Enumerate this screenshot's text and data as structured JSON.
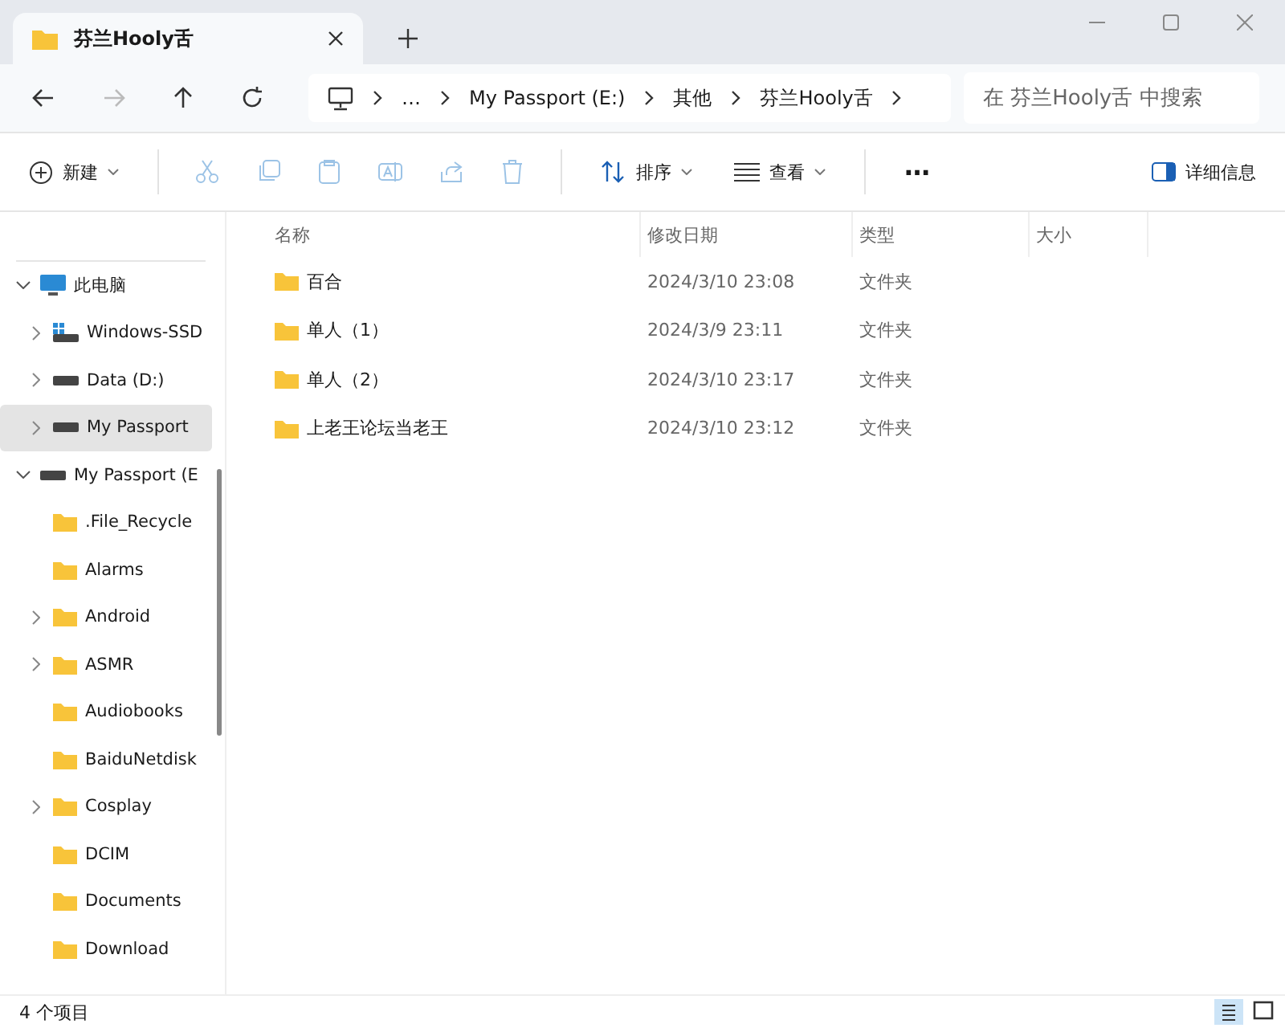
{
  "window": {
    "tab_title": "芬兰Hooly舌"
  },
  "address": {
    "crumbs": [
      "…",
      "My Passport (E:)",
      "其他",
      "芬兰Hooly舌"
    ],
    "search_placeholder": "在 芬兰Hooly舌 中搜索"
  },
  "toolbar": {
    "new": "新建",
    "sort": "排序",
    "view": "查看",
    "more": "⋯",
    "details": "详细信息"
  },
  "sidebar": {
    "items": [
      {
        "label": "此电脑",
        "kind": "pc",
        "expandable": true,
        "expanded": true,
        "selected": false,
        "children": [
          {
            "label": "Windows-SSD",
            "kind": "system-drive",
            "expandable": true,
            "expanded": false,
            "selected": false
          },
          {
            "label": "Data (D:)",
            "kind": "drive",
            "expandable": true,
            "expanded": false,
            "selected": false
          },
          {
            "label": "My Passport",
            "kind": "drive",
            "expandable": true,
            "expanded": false,
            "selected": true
          }
        ]
      },
      {
        "label": "My Passport (E",
        "kind": "drive",
        "expandable": true,
        "expanded": true,
        "selected": false,
        "children": [
          {
            "label": ".File_Recycle",
            "kind": "folder",
            "expandable": false,
            "selected": false
          },
          {
            "label": "Alarms",
            "kind": "folder",
            "expandable": false,
            "selected": false
          },
          {
            "label": "Android",
            "kind": "folder",
            "expandable": true,
            "expanded": false,
            "selected": false
          },
          {
            "label": "ASMR",
            "kind": "folder",
            "expandable": true,
            "expanded": false,
            "selected": false
          },
          {
            "label": "Audiobooks",
            "kind": "folder",
            "expandable": false,
            "selected": false
          },
          {
            "label": "BaiduNetdisk",
            "kind": "folder",
            "expandable": false,
            "selected": false
          },
          {
            "label": "Cosplay",
            "kind": "folder",
            "expandable": true,
            "expanded": false,
            "selected": false
          },
          {
            "label": "DCIM",
            "kind": "folder",
            "expandable": false,
            "selected": false
          },
          {
            "label": "Documents",
            "kind": "folder",
            "expandable": false,
            "selected": false
          },
          {
            "label": "Download",
            "kind": "folder",
            "expandable": false,
            "selected": false
          }
        ]
      }
    ]
  },
  "table": {
    "columns": [
      "名称",
      "修改日期",
      "类型",
      "大小"
    ],
    "rows": [
      {
        "name": "百合",
        "modified": "2024/3/10 23:08",
        "type": "文件夹"
      },
      {
        "name": "单人（1）",
        "modified": "2024/3/9 23:11",
        "type": "文件夹"
      },
      {
        "name": "单人（2）",
        "modified": "2024/3/10 23:17",
        "type": "文件夹"
      },
      {
        "name": "上老王论坛当老王",
        "modified": "2024/3/10 23:12",
        "type": "文件夹"
      }
    ]
  },
  "status_bar": {
    "count": "4 个项目"
  }
}
